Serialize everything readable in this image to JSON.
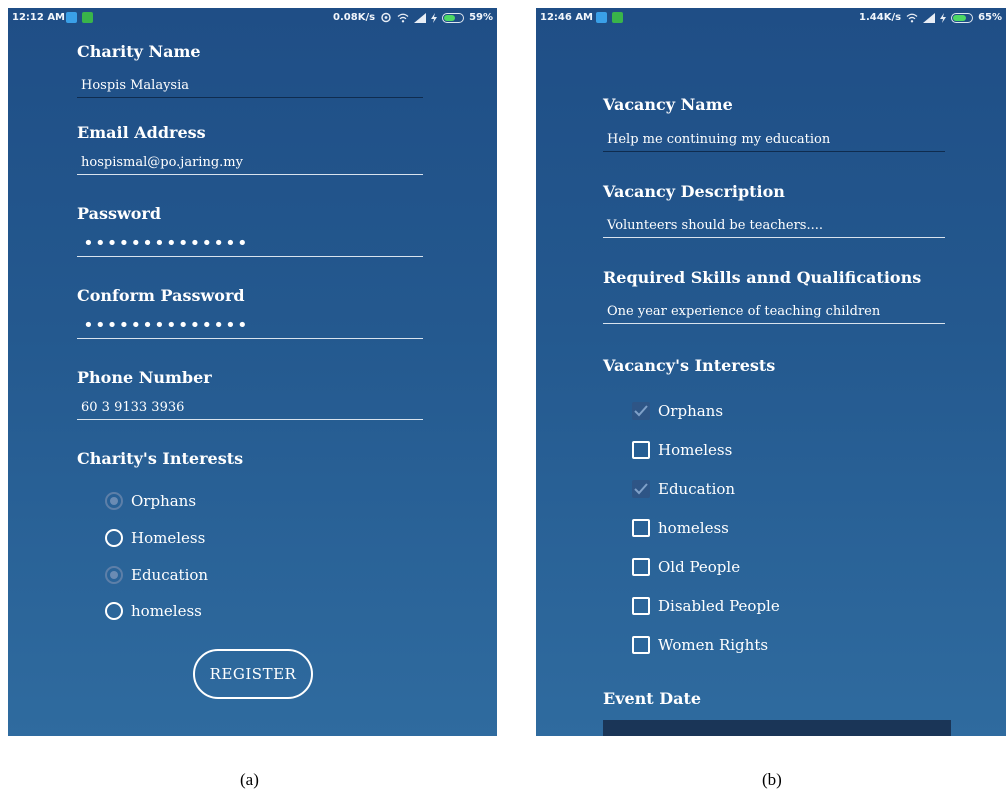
{
  "screen_a": {
    "status_bar": {
      "time": "12:12 AM",
      "speed": "0.08K/s",
      "battery": "59%"
    },
    "fields": [
      {
        "label": "Charity Name",
        "value": "Hospis Malaysia"
      },
      {
        "label": "Email Address",
        "value": "hospismal@po.jaring.my"
      },
      {
        "label": "Password",
        "value": "••••••••••••••"
      },
      {
        "label": "Conform Password",
        "value": "••••••••••••••"
      },
      {
        "label": "Phone Number",
        "value": "60 3 9133 3936"
      }
    ],
    "interests_title": "Charity's Interests",
    "interests": [
      {
        "label": "Orphans",
        "checked": true
      },
      {
        "label": "Homeless",
        "checked": false
      },
      {
        "label": "Education",
        "checked": true
      },
      {
        "label": "homeless",
        "checked": false
      }
    ],
    "register_label": "REGISTER",
    "caption": "(a)"
  },
  "screen_b": {
    "status_bar": {
      "time": "12:46 AM",
      "speed": "1.44K/s",
      "battery": "65%"
    },
    "fields": [
      {
        "label": "Vacancy Name",
        "value": "Help me continuing my education"
      },
      {
        "label": "Vacancy Description",
        "value": "Volunteers should be teachers...."
      },
      {
        "label": "Required Skills annd Qualifications",
        "value": "One year experience of teaching children"
      }
    ],
    "interests_title": "Vacancy's Interests",
    "interests": [
      {
        "label": "Orphans",
        "checked": true
      },
      {
        "label": "Homeless",
        "checked": false
      },
      {
        "label": "Education",
        "checked": true
      },
      {
        "label": "homeless",
        "checked": false
      },
      {
        "label": "Old People",
        "checked": false
      },
      {
        "label": "Disabled People",
        "checked": false
      },
      {
        "label": "Women Rights",
        "checked": false
      }
    ],
    "event_date_label": "Event Date",
    "caption": "(b)"
  },
  "icons": {
    "notification_1": "app-notification-icon",
    "notification_2": "app-notification-icon",
    "sync": "sync-icon",
    "wifi": "wifi-icon",
    "signal": "signal-icon",
    "charging": "charging-icon",
    "battery": "battery-icon",
    "check": "check-icon"
  },
  "colors": {
    "background_top": "#1f4e86",
    "background_bottom": "#2f6b9f",
    "checked_box": "#2e5586",
    "battery_fill": "#4cd964"
  }
}
